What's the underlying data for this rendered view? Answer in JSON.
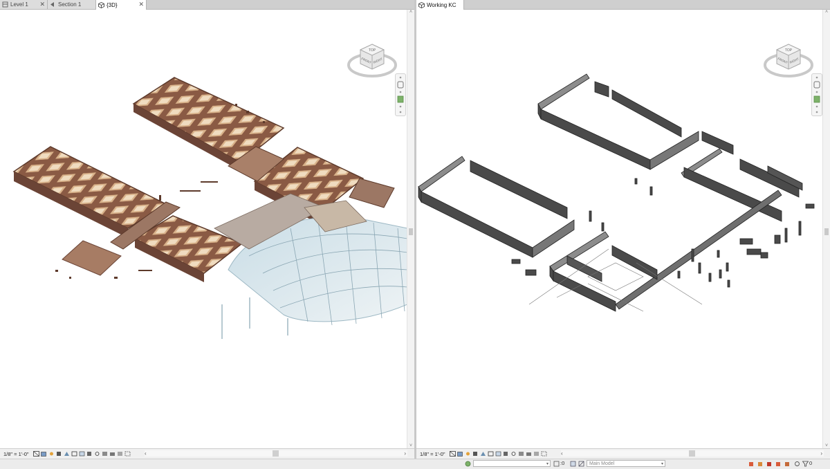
{
  "tabs_left": [
    {
      "label": "Level 1",
      "icon": "floor-plan-icon"
    },
    {
      "label": "Section 1",
      "icon": "section-icon"
    },
    {
      "label": "{3D}",
      "icon": "3d-view-icon",
      "active": true
    }
  ],
  "tabs_right": [
    {
      "label": "Working KC",
      "icon": "3d-view-icon",
      "active": true
    }
  ],
  "left_view": {
    "scale": "1/8\" = 1'-0\""
  },
  "right_view": {
    "scale": "1/8\" = 1'-0\""
  },
  "navcube": {
    "top": "TOP",
    "front": "FRONT",
    "right": "RIGHT"
  },
  "bottom_bar": {
    "workset_value": "",
    "coord_value": ":0",
    "model_value": "Main Model",
    "filter_count": "0"
  },
  "colors": {
    "pointcloud_brown": "#8a5a44",
    "room_light": "#e6c6a0",
    "wall_dark": "#4a4a4a",
    "wall_light": "#8c8c8c",
    "tab_active": "#ffffff",
    "status_bg": "#f0f0f0"
  }
}
